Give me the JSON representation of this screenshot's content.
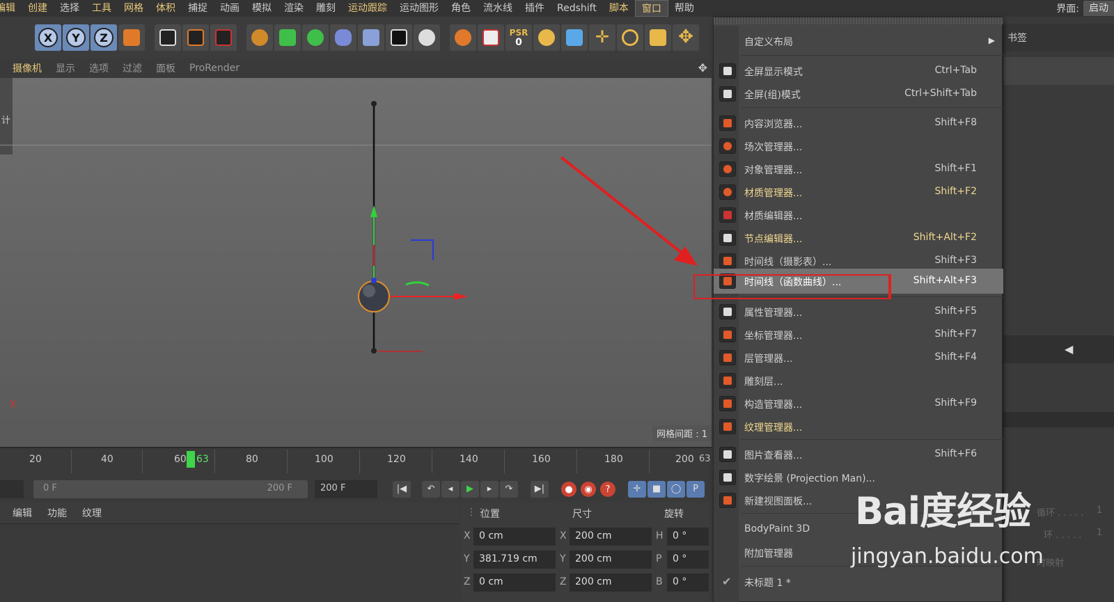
{
  "menubar": {
    "items": [
      {
        "label": "编辑",
        "color": "orange"
      },
      {
        "label": "创建",
        "color": "orange"
      },
      {
        "label": "选择",
        "color": "plain"
      },
      {
        "label": "工具",
        "color": "orange"
      },
      {
        "label": "网格",
        "color": "orange"
      },
      {
        "label": "体积",
        "color": "orange"
      },
      {
        "label": "捕捉",
        "color": "plain"
      },
      {
        "label": "动画",
        "color": "plain"
      },
      {
        "label": "模拟",
        "color": "plain"
      },
      {
        "label": "渲染",
        "color": "plain"
      },
      {
        "label": "雕刻",
        "color": "plain"
      },
      {
        "label": "运动跟踪",
        "color": "orange"
      },
      {
        "label": "运动图形",
        "color": "plain"
      },
      {
        "label": "角色",
        "color": "plain"
      },
      {
        "label": "流水线",
        "color": "plain"
      },
      {
        "label": "插件",
        "color": "plain"
      },
      {
        "label": "Redshift",
        "color": "plain"
      },
      {
        "label": "脚本",
        "color": "orange"
      },
      {
        "label": "窗口",
        "color": "active"
      },
      {
        "label": "帮助",
        "color": "plain"
      }
    ],
    "layout_label": "界面:",
    "layout_value": "启动"
  },
  "toolbar": {
    "axis_x": "X",
    "axis_y": "Y",
    "axis_z": "Z",
    "psr_label": "PSR",
    "psr_value": "0"
  },
  "viewport_menu": {
    "items": [
      "摄像机",
      "显示",
      "选项",
      "过滤",
      "面板",
      "ProRender"
    ]
  },
  "viewport": {
    "left_label": "计",
    "grid_spacing": "网格间距 : 1",
    "axis_x_label": "X"
  },
  "timeline": {
    "ticks": [
      "20",
      "40",
      "60",
      "80",
      "100",
      "120",
      "140",
      "160",
      "180",
      "200"
    ],
    "current_frame": "63",
    "end_label": "63"
  },
  "transport": {
    "range_start": "0 F",
    "range_end": "200 F",
    "end_frame": "200 F"
  },
  "attr_bar": {
    "tabs": [
      "编辑",
      "功能",
      "纹理"
    ]
  },
  "coords": {
    "headers": {
      "position": "位置",
      "size": "尺寸",
      "rotation": "旋转"
    },
    "rows": [
      {
        "axis": "X",
        "pos": "0 cm",
        "size_axis": "X",
        "size": "200 cm",
        "rot_axis": "H",
        "rot": "0 °"
      },
      {
        "axis": "Y",
        "pos": "381.719 cm",
        "size_axis": "Y",
        "size": "200 cm",
        "rot_axis": "P",
        "rot": "0 °"
      },
      {
        "axis": "Z",
        "pos": "0 cm",
        "size_axis": "Z",
        "size": "200 cm",
        "rot_axis": "B",
        "rot": "0 °"
      }
    ]
  },
  "right_panel": {
    "tab": "书签",
    "dim1": "循环 . . . . .",
    "dim1_val": "1",
    "dim2": "环 . . . . .",
    "dim2_val": "1",
    "dim3": "时映射"
  },
  "window_menu": {
    "items": [
      {
        "label": "自定义布局",
        "shortcut": "",
        "submenu": true,
        "icon": "none"
      },
      {
        "label": "全屏显示模式",
        "shortcut": "Ctrl+Tab",
        "icon": "fullscreen-icon"
      },
      {
        "label": "全屏(组)模式",
        "shortcut": "Ctrl+Shift+Tab",
        "icon": "fullscreen-group-icon"
      },
      {
        "label": "内容浏览器...",
        "shortcut": "Shift+F8",
        "icon": "content-browser-icon"
      },
      {
        "label": "场次管理器...",
        "shortcut": "",
        "icon": "take-manager-icon"
      },
      {
        "label": "对象管理器...",
        "shortcut": "Shift+F1",
        "icon": "object-manager-icon"
      },
      {
        "label": "材质管理器...",
        "shortcut": "Shift+F2",
        "icon": "material-manager-icon",
        "highlight": true
      },
      {
        "label": "材质编辑器...",
        "shortcut": "",
        "icon": "material-editor-icon"
      },
      {
        "label": "节点编辑器...",
        "shortcut": "Shift+Alt+F2",
        "icon": "node-editor-icon",
        "highlight": true
      },
      {
        "label": "时间线（摄影表）...",
        "shortcut": "Shift+F3",
        "icon": "timeline-dopesheet-icon"
      },
      {
        "label": "时间线（函数曲线）...",
        "shortcut": "Shift+Alt+F3",
        "icon": "timeline-fcurve-icon",
        "selected": true
      },
      {
        "label": "属性管理器...",
        "shortcut": "Shift+F5",
        "icon": "attribute-manager-icon"
      },
      {
        "label": "坐标管理器...",
        "shortcut": "Shift+F7",
        "icon": "coordinate-manager-icon"
      },
      {
        "label": "层管理器...",
        "shortcut": "Shift+F4",
        "icon": "layer-manager-icon"
      },
      {
        "label": "雕刻层...",
        "shortcut": "",
        "icon": "sculpt-layer-icon"
      },
      {
        "label": "构造管理器...",
        "shortcut": "Shift+F9",
        "icon": "structure-manager-icon"
      },
      {
        "label": "纹理管理器...",
        "shortcut": "",
        "icon": "texture-manager-icon",
        "highlight": true
      },
      {
        "label": "图片查看器...",
        "shortcut": "Shift+F6",
        "icon": "picture-viewer-icon"
      },
      {
        "label": "数字绘景 (Projection Man)...",
        "shortcut": "",
        "icon": "projection-man-icon"
      },
      {
        "label": "新建视图面板...",
        "shortcut": "",
        "icon": "new-view-panel-icon"
      },
      {
        "label": "BodyPaint 3D",
        "shortcut": "",
        "icon": "none"
      },
      {
        "label": "附加管理器",
        "shortcut": "",
        "icon": "none"
      },
      {
        "label": "未标题 1 *",
        "shortcut": "",
        "icon": "checkmark-icon"
      }
    ]
  },
  "watermark": {
    "logo": "Bai度经验",
    "url": "jingyan.baidu.com"
  },
  "colors": {
    "menu_accent": "#e8c87a",
    "red_annotation": "#e02020",
    "timeline_marker": "#3fd44a"
  }
}
